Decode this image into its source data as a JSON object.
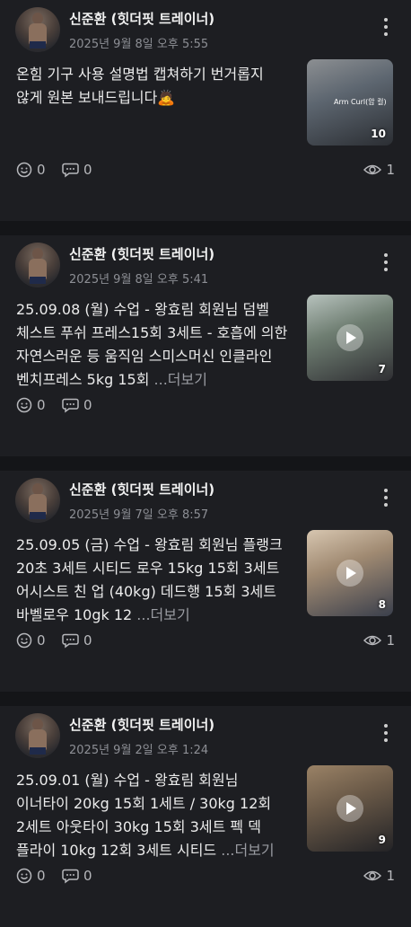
{
  "posts": [
    {
      "author": "신준환 (힛더핏 트레이너)",
      "date": "2025년 9월 8일 오후 5:55",
      "text": "온힘 기구 사용 설명법  캡쳐하기 번거롭지 않게 원본 보내드립니다🙇",
      "more": "",
      "thumb_count": "10",
      "thumb_caption": "Arm Curl(암 컬)",
      "has_play": false,
      "reactions": "0",
      "comments": "0",
      "views": "1",
      "thumb_colors": [
        "#5d6670",
        "#2b2e33",
        "#8c8f92"
      ]
    },
    {
      "author": "신준환 (힛더핏 트레이너)",
      "date": "2025년 9월 8일 오후 5:41",
      "text": "25.09.08 (월) 수업 - 왕효림 회원님 덤벨 체스트 푸쉬 프레스15회 3세트 - 호흡에 의한 자연스러운 등 움직임 스미스머신 인클라인 벤치프레스 5kg 15회  ",
      "more": "...더보기",
      "thumb_count": "7",
      "thumb_caption": "",
      "has_play": true,
      "reactions": "0",
      "comments": "0",
      "views": "",
      "thumb_colors": [
        "#6f7e72",
        "#2f2f33",
        "#b7c2bd"
      ]
    },
    {
      "author": "신준환 (힛더핏 트레이너)",
      "date": "2025년 9월 7일 오후 8:57",
      "text": "25.09.05 (금) 수업 - 왕효림 회원님 플랭크 20초 3세트 시티드 로우 15kg 15회 3세트 어시스트 친 업 (40kg) 데드행 15회 3세트 바벨로우 10gk 12 ",
      "more": "...더보기",
      "thumb_count": "8",
      "thumb_caption": "",
      "has_play": true,
      "reactions": "0",
      "comments": "0",
      "views": "1",
      "thumb_colors": [
        "#a08a72",
        "#3a3f4c",
        "#d7c6b0"
      ]
    },
    {
      "author": "신준환 (힛더핏 트레이너)",
      "date": "2025년 9월 2일 오후 1:24",
      "text": "25.09.01 (월) 수업 - 왕효림 회원님 이너타이 20kg 15회 1세트 / 30kg 12회 2세트 아웃타이 30kg 15회 3세트 펙 덱 플라이 10kg 12회 3세트 시티드 ",
      "more": "...더보기",
      "thumb_count": "9",
      "thumb_caption": "",
      "has_play": true,
      "reactions": "0",
      "comments": "0",
      "views": "1",
      "thumb_colors": [
        "#6b5a48",
        "#232326",
        "#9a8266"
      ]
    }
  ]
}
